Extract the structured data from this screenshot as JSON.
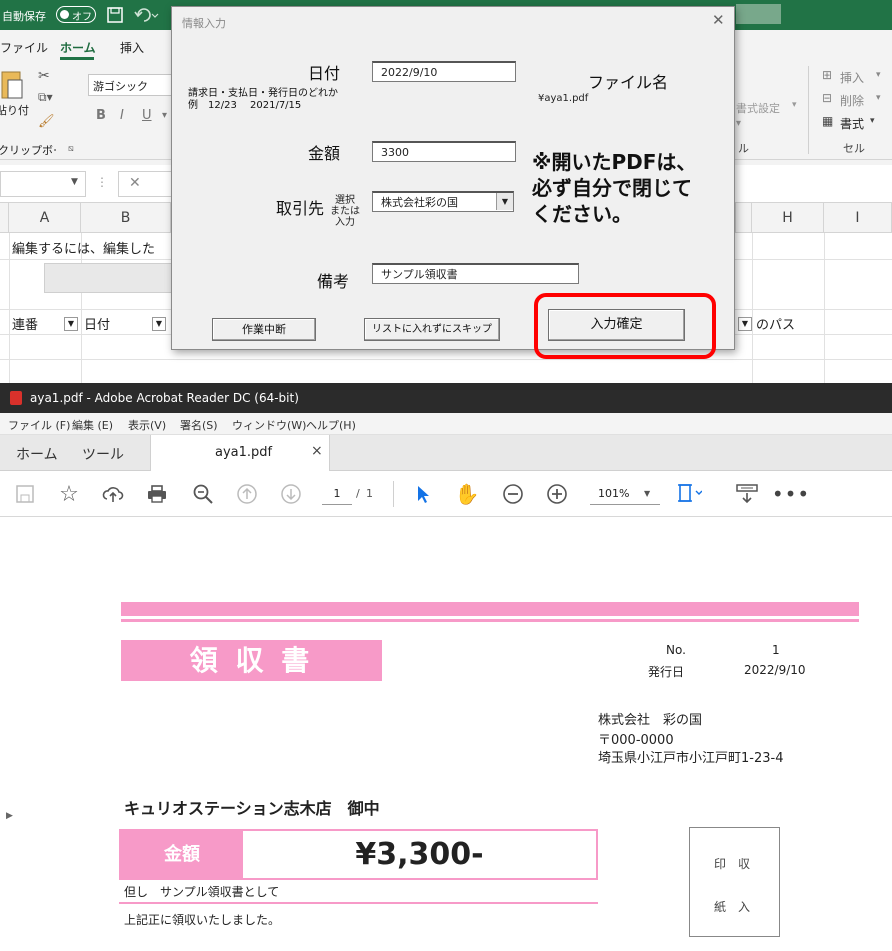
{
  "excel": {
    "autosave_label": "自動保存",
    "autosave_state": "オフ",
    "tabs": [
      "ファイル",
      "ホーム",
      "挿入"
    ],
    "ribbon": {
      "paste_label": "貼り付け",
      "font_name": "游ゴシック",
      "clipboard_group": "クリップボード",
      "style_items": [
        "書式設定"
      ],
      "cell_items": [
        "挿入",
        "削除",
        "書式"
      ],
      "cell_group": "セル",
      "right_label": "ル"
    },
    "columns": [
      "A",
      "B",
      "H",
      "I"
    ],
    "row1_text": "編集するには、編集した",
    "header_cells": [
      "連番",
      "日付",
      "のパス"
    ]
  },
  "dialog": {
    "title": "情報入力",
    "date_label": "日付",
    "date_value": "2022/9/10",
    "date_hint1": "請求日・支払日・発行日のどれか",
    "date_hint2": "例　12/23　 2021/7/15",
    "filename_label": "ファイル名",
    "filename_value": "¥aya1.pdf",
    "amount_label": "金額",
    "amount_value": "3300",
    "notice": "※開いたPDFは、必ず自分で閉じてください。",
    "notice_l1": "※開いたPDFは、",
    "notice_l2": "必ず自分で閉じて",
    "notice_l3": "ください。",
    "partner_label": "取引先",
    "partner_hint1": "選択",
    "partner_hint2": "または",
    "partner_hint3": "入力",
    "partner_value": "株式会社彩の国",
    "memo_label": "備考",
    "memo_value": "サンプル領収書",
    "btn_cancel": "作業中断",
    "btn_skip": "リストに入れずにスキップ",
    "btn_confirm": "入力確定"
  },
  "acrobat": {
    "title": "aya1.pdf - Adobe Acrobat Reader DC (64-bit)",
    "menu": [
      "ファイル (F)",
      "編集 (E)",
      "表示(V)",
      "署名(S)",
      "ウィンドウ(W)",
      "ヘルプ(H)"
    ],
    "tab_home": "ホーム",
    "tab_tools": "ツール",
    "tab_doc": "aya1.pdf",
    "page_current": "1",
    "page_sep": "/",
    "page_total": "1",
    "zoom": "101%"
  },
  "receipt": {
    "title": "領 収 書",
    "no_label": "No.",
    "no_value": "1",
    "date_label": "発行日",
    "date_value": "2022/9/10",
    "issuer_name": "株式会社　彩の国",
    "issuer_zip": "〒000-0000",
    "issuer_addr": "埼玉県小江戸市小江戸町1-23-4",
    "recipient": "キュリオステーション志木店　御中",
    "amount_label": "金額",
    "amount_value": "¥3,300-",
    "tadashi": "但し　サンプル領収書として",
    "confirm": "上記正に領収いたしました。",
    "stamp_line1": "印　収",
    "stamp_line2": "紙　入"
  }
}
